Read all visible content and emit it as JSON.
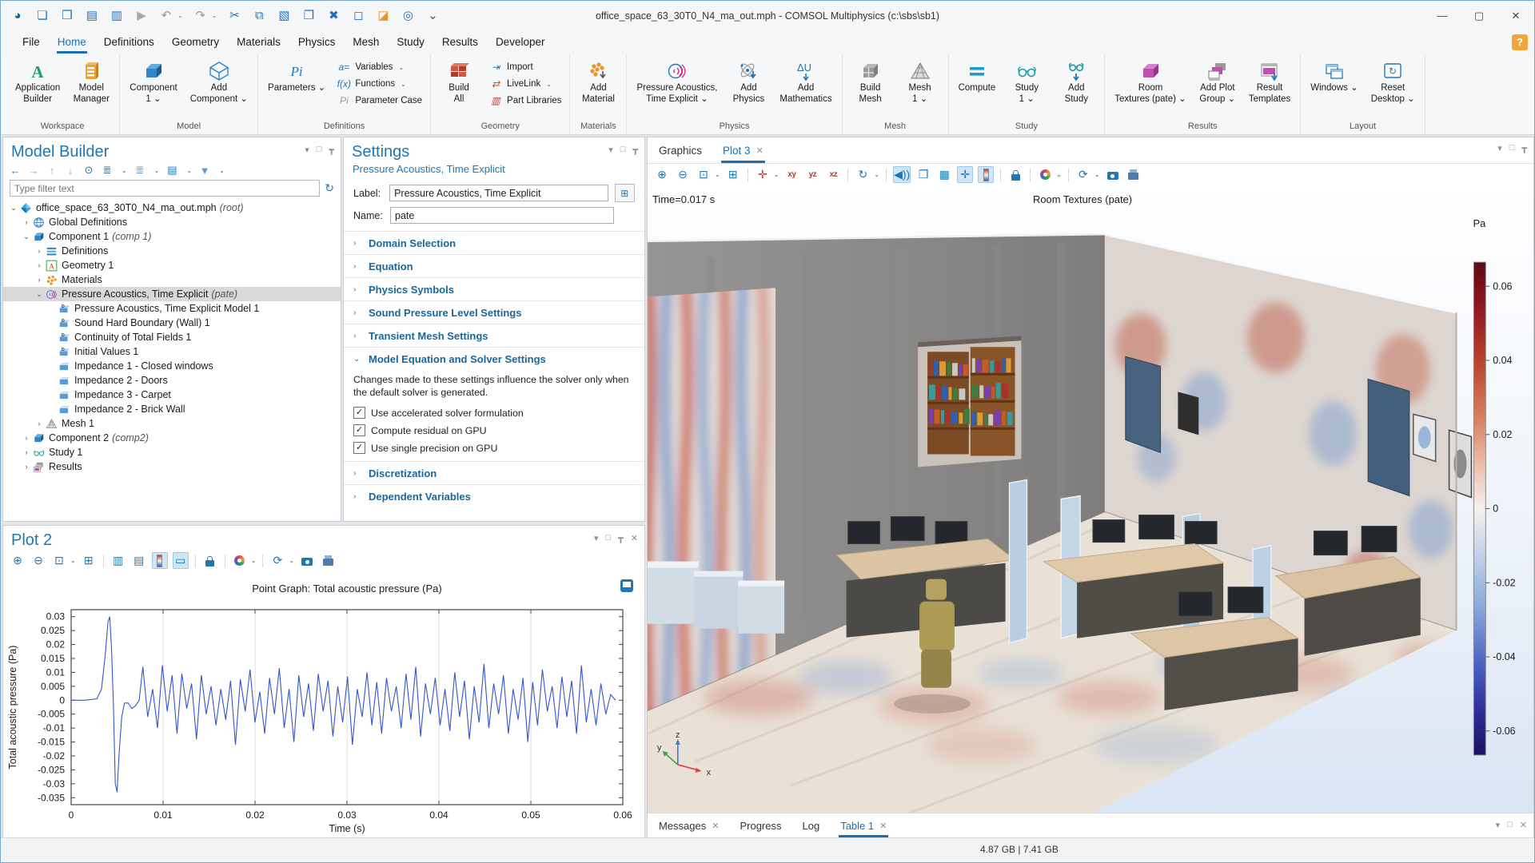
{
  "window": {
    "title": "office_space_63_30T0_N4_ma_out.mph - COMSOL Multiphysics (c:\\sbs\\sb1)"
  },
  "titlebar": {
    "quick_access": [
      "app-logo-icon",
      "new-file-icon",
      "open-file-icon",
      "save-icon",
      "save-as-icon",
      "run-icon",
      "undo-icon",
      "redo-icon",
      "cut-icon",
      "copy-icon",
      "paste-icon",
      "duplicate-icon",
      "delete-icon",
      "select-box-icon",
      "clear-selection-icon",
      "log-icon",
      "toolbar-overflow-icon"
    ]
  },
  "menus": {
    "items": [
      "File",
      "Home",
      "Definitions",
      "Geometry",
      "Materials",
      "Physics",
      "Mesh",
      "Study",
      "Results",
      "Developer"
    ],
    "active": "Home",
    "help_label": "?"
  },
  "ribbon": {
    "groups": [
      {
        "label": "Workspace",
        "items": [
          {
            "kind": "large",
            "icon": "application-builder-icon",
            "label": "Application\nBuilder"
          },
          {
            "kind": "large",
            "icon": "model-manager-icon",
            "label": "Model\nManager"
          }
        ]
      },
      {
        "label": "Model",
        "items": [
          {
            "kind": "large",
            "icon": "component-icon",
            "label": "Component\n1",
            "caret": true
          },
          {
            "kind": "large",
            "icon": "add-component-icon",
            "label": "Add\nComponent",
            "caret": true
          }
        ]
      },
      {
        "label": "Definitions",
        "items": [
          {
            "kind": "large",
            "icon": "parameters-icon",
            "label": "Parameters",
            "caret": true
          },
          {
            "kind": "col",
            "buttons": [
              {
                "icon": "variables-icon",
                "label": "Variables",
                "caret": true
              },
              {
                "icon": "functions-icon",
                "label": "Functions",
                "caret": true
              },
              {
                "icon": "parameter-case-icon",
                "label": "Parameter Case"
              }
            ]
          }
        ]
      },
      {
        "label": "Geometry",
        "items": [
          {
            "kind": "large",
            "icon": "build-all-icon",
            "label": "Build\nAll"
          },
          {
            "kind": "col",
            "buttons": [
              {
                "icon": "import-icon",
                "label": "Import"
              },
              {
                "icon": "livelink-icon",
                "label": "LiveLink",
                "caret": true
              },
              {
                "icon": "part-libraries-icon",
                "label": "Part Libraries"
              }
            ]
          }
        ]
      },
      {
        "label": "Materials",
        "items": [
          {
            "kind": "large",
            "icon": "add-material-icon",
            "label": "Add\nMaterial"
          }
        ]
      },
      {
        "label": "Physics",
        "items": [
          {
            "kind": "large",
            "icon": "pressure-acoustics-icon",
            "label": "Pressure Acoustics,\nTime Explicit",
            "caret": true
          },
          {
            "kind": "large",
            "icon": "add-physics-icon",
            "label": "Add\nPhysics"
          },
          {
            "kind": "large",
            "icon": "add-mathematics-icon",
            "label": "Add\nMathematics"
          }
        ]
      },
      {
        "label": "Mesh",
        "items": [
          {
            "kind": "large",
            "icon": "build-mesh-icon",
            "label": "Build\nMesh"
          },
          {
            "kind": "large",
            "icon": "mesh-icon",
            "label": "Mesh\n1",
            "caret": true
          }
        ]
      },
      {
        "label": "Study",
        "items": [
          {
            "kind": "large",
            "icon": "compute-icon",
            "label": "Compute"
          },
          {
            "kind": "large",
            "icon": "study-icon",
            "label": "Study\n1",
            "caret": true
          },
          {
            "kind": "large",
            "icon": "add-study-icon",
            "label": "Add\nStudy"
          }
        ]
      },
      {
        "label": "Results",
        "items": [
          {
            "kind": "large",
            "icon": "room-textures-icon",
            "label": "Room\nTextures (pate)",
            "caret": true
          },
          {
            "kind": "large",
            "icon": "add-plot-group-icon",
            "label": "Add Plot\nGroup",
            "caret": true
          },
          {
            "kind": "large",
            "icon": "result-templates-icon",
            "label": "Result\nTemplates"
          }
        ]
      },
      {
        "label": "Layout",
        "items": [
          {
            "kind": "large",
            "icon": "windows-icon",
            "label": "Windows",
            "caret": true
          },
          {
            "kind": "large",
            "icon": "reset-desktop-icon",
            "label": "Reset\nDesktop",
            "caret": true
          }
        ]
      }
    ]
  },
  "model_builder": {
    "title": "Model Builder",
    "filter_placeholder": "Type filter text",
    "toolbar": [
      "go-back-icon",
      "go-forward-icon",
      "move-up-icon",
      "move-down-icon",
      "show-icon",
      "expand-icon",
      "collapse-icon",
      "model-tree-nodes-icon",
      "filter-icon"
    ],
    "tree": [
      {
        "indent": 0,
        "exp": "v",
        "icon": "model-root-icon",
        "label": "office_space_63_30T0_N4_ma_out.mph",
        "suffix": "(root)"
      },
      {
        "indent": 1,
        "exp": ">",
        "icon": "global-definitions-icon",
        "label": "Global Definitions"
      },
      {
        "indent": 1,
        "exp": "v",
        "icon": "component-icon",
        "label": "Component 1",
        "suffix": "(comp 1)"
      },
      {
        "indent": 2,
        "exp": ">",
        "icon": "definitions-icon",
        "label": "Definitions"
      },
      {
        "indent": 2,
        "exp": ">",
        "icon": "geometry-icon",
        "label": "Geometry 1"
      },
      {
        "indent": 2,
        "exp": ">",
        "icon": "materials-icon",
        "label": "Materials"
      },
      {
        "indent": 2,
        "exp": "v",
        "icon": "pressure-acoustics-icon",
        "label": "Pressure Acoustics, Time Explicit",
        "suffix": "(pate)",
        "selected": true
      },
      {
        "indent": 3,
        "icon": "physics-feature-d-icon",
        "label": "Pressure Acoustics, Time Explicit Model 1"
      },
      {
        "indent": 3,
        "icon": "physics-feature-d-icon",
        "label": "Sound Hard Boundary (Wall) 1"
      },
      {
        "indent": 3,
        "icon": "physics-feature-d-icon",
        "label": "Continuity of Total Fields 1"
      },
      {
        "indent": 3,
        "icon": "physics-feature-d-icon",
        "label": "Initial Values 1"
      },
      {
        "indent": 3,
        "icon": "physics-feature-icon",
        "label": "Impedance 1 - Closed windows"
      },
      {
        "indent": 3,
        "icon": "physics-feature-icon",
        "label": "Impedance 2 - Doors"
      },
      {
        "indent": 3,
        "icon": "physics-feature-icon",
        "label": "Impedance 3 - Carpet"
      },
      {
        "indent": 3,
        "icon": "physics-feature-icon",
        "label": "Impedance 2 - Brick Wall"
      },
      {
        "indent": 2,
        "exp": ">",
        "icon": "mesh-icon",
        "label": "Mesh 1"
      },
      {
        "indent": 1,
        "exp": ">",
        "icon": "component-icon",
        "label": "Component 2",
        "suffix": "(comp2)"
      },
      {
        "indent": 1,
        "exp": ">",
        "icon": "study-icon",
        "label": "Study 1"
      },
      {
        "indent": 1,
        "exp": ">",
        "icon": "results-icon",
        "label": "Results"
      }
    ]
  },
  "settings": {
    "title": "Settings",
    "subtitle": "Pressure Acoustics, Time Explicit",
    "label_label": "Label:",
    "label_value": "Pressure Acoustics, Time Explicit",
    "name_label": "Name:",
    "name_value": "pate",
    "sections": [
      {
        "label": "Domain Selection"
      },
      {
        "label": "Equation"
      },
      {
        "label": "Physics Symbols"
      },
      {
        "label": "Sound Pressure Level Settings"
      },
      {
        "label": "Transient Mesh Settings"
      },
      {
        "label": "Model Equation and Solver Settings",
        "expanded": true,
        "note": "Changes made to these settings influence the solver only when the default solver is generated.",
        "checkboxes": [
          {
            "label": "Use accelerated solver formulation",
            "checked": true
          },
          {
            "label": "Compute residual on GPU",
            "checked": true
          },
          {
            "label": "Use single precision on GPU",
            "checked": true
          }
        ]
      },
      {
        "label": "Discretization"
      },
      {
        "label": "Dependent Variables"
      }
    ]
  },
  "plot2": {
    "title": "Plot 2"
  },
  "graphics": {
    "tabs": [
      {
        "label": "Graphics"
      },
      {
        "label": "Plot 3",
        "closable": true,
        "active": true
      }
    ],
    "time_label": "Time=0.017 s",
    "plot_title": "Room Textures (pate)",
    "colorbar_unit": "Pa",
    "colorbar_ticks": [
      "0.06",
      "0.04",
      "0.02",
      "0",
      "-0.02",
      "-0.04",
      "-0.06"
    ],
    "axis_triad": {
      "x": "x",
      "y": "y",
      "z": "z"
    }
  },
  "bottom_tabs": [
    {
      "label": "Messages",
      "closable": true
    },
    {
      "label": "Progress"
    },
    {
      "label": "Log"
    },
    {
      "label": "Table 1",
      "closable": true,
      "active": true
    }
  ],
  "status_bar": {
    "memory": "4.87 GB | 7.41 GB"
  },
  "chart_data": {
    "type": "line",
    "title": "Point Graph: Total acoustic pressure (Pa)",
    "xlabel": "Time (s)",
    "ylabel": "Total acoustic pressure (Pa)",
    "xlim": [
      0,
      0.06
    ],
    "ylim": [
      -0.0375,
      0.0325
    ],
    "x_ticks": [
      0,
      0.01,
      0.02,
      0.03,
      0.04,
      0.05,
      0.06
    ],
    "y_ticks": [
      0.03,
      0.025,
      0.02,
      0.015,
      0.01,
      0.005,
      0,
      -0.005,
      -0.01,
      -0.015,
      -0.02,
      -0.025,
      -0.03,
      -0.035
    ],
    "line_color": "#3355cc",
    "grid": true,
    "legend": "none",
    "series_head": [
      [
        0,
        0
      ],
      [
        0.0015,
        0
      ],
      [
        0.0028,
        0.0005
      ],
      [
        0.0033,
        0.004
      ],
      [
        0.0037,
        0.016
      ],
      [
        0.004,
        0.028
      ],
      [
        0.0042,
        0.03
      ],
      [
        0.0044,
        0.018
      ],
      [
        0.0046,
        -0.002
      ],
      [
        0.0048,
        -0.03
      ],
      [
        0.005,
        -0.033
      ],
      [
        0.0052,
        -0.02
      ],
      [
        0.0055,
        -0.006
      ],
      [
        0.0058,
        -0.001
      ],
      [
        0.0062,
        -0.001
      ],
      [
        0.0066,
        -0.003
      ],
      [
        0.007,
        -0.002
      ],
      [
        0.0074,
        0
      ]
    ],
    "series_osc": {
      "t0": 0.0078,
      "dt": 0.00053,
      "values": [
        0.012,
        -0.006,
        0.004,
        -0.01,
        0.0125,
        -0.004,
        0.009,
        -0.012,
        0.0095,
        -0.003,
        0.006,
        -0.014,
        0.009,
        -0.005,
        0.005,
        -0.009,
        0.004,
        -0.007,
        0.007,
        -0.016,
        0.0075,
        -0.004,
        0.011,
        -0.008,
        0.003,
        -0.012,
        0.008,
        -0.005,
        0.0115,
        -0.01,
        0.004,
        -0.015,
        0.009,
        -0.006,
        0.006,
        -0.011,
        0.0095,
        -0.004,
        0.007,
        -0.013,
        0.005,
        -0.008,
        0.0085,
        -0.016,
        0.004,
        -0.006,
        0.01,
        -0.009,
        0.0065,
        -0.012,
        0.008,
        -0.004,
        0.005,
        -0.01,
        0.0095,
        -0.007,
        0.012,
        -0.013,
        0.006,
        -0.005,
        0.008,
        -0.009,
        0.004,
        -0.011,
        0.01,
        -0.006,
        0.007,
        -0.014,
        0.005,
        -0.008,
        0.013,
        -0.01,
        0.006,
        -0.005,
        0.009,
        -0.012,
        0.004,
        -0.007,
        0.008,
        -0.015,
        0.0065,
        -0.009,
        0.011,
        -0.004,
        0.005,
        -0.01,
        0.0085,
        -0.006,
        0.007,
        -0.012,
        0.0125,
        -0.008,
        0.004,
        -0.009,
        0.006,
        -0.005,
        0.002,
        0
      ]
    }
  }
}
